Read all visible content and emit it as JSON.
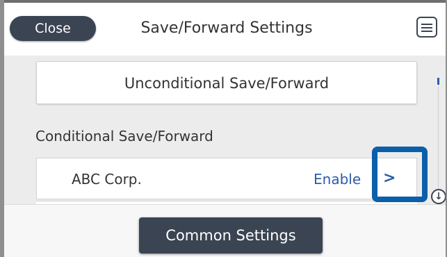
{
  "header": {
    "close_label": "Close",
    "title": "Save/Forward Settings",
    "menu_icon": "list-menu-icon"
  },
  "main": {
    "unconditional_label": "Unconditional Save/Forward",
    "conditional_section_label": "Conditional Save/Forward",
    "items": [
      {
        "name": "ABC Corp.",
        "status": "Enable",
        "chevron": ">"
      }
    ],
    "scroll_down_glyph": "↓"
  },
  "footer": {
    "common_settings_label": "Common Settings"
  },
  "colors": {
    "dark_button": "#3b4452",
    "accent_blue": "#2b5da8",
    "highlight_border": "#0b5faa",
    "background": "#ececec"
  }
}
